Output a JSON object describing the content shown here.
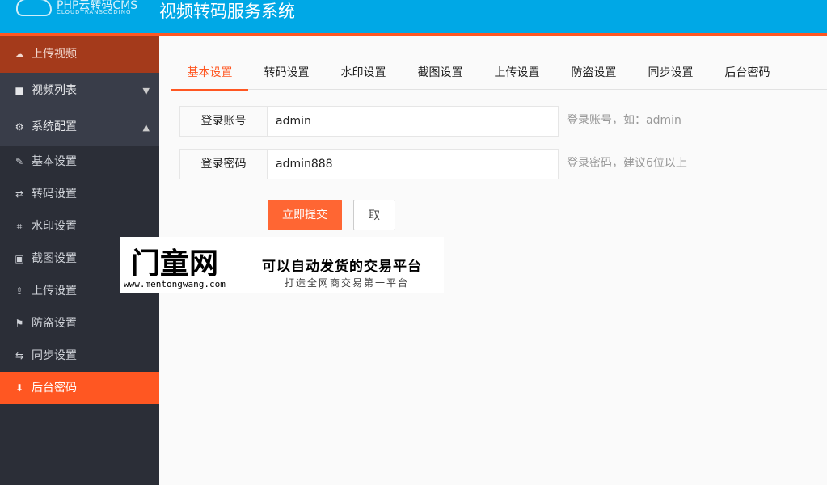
{
  "header": {
    "logo_name": "PHP云转码CMS",
    "logo_sub": "CLOUDTRANSCODING",
    "title": "视频转码服务系统"
  },
  "sidebar": {
    "upload": "上传视频",
    "video_list": "视频列表",
    "config": "系统配置",
    "items": [
      "基本设置",
      "转码设置",
      "水印设置",
      "截图设置",
      "上传设置",
      "防盗设置",
      "同步设置",
      "后台密码"
    ]
  },
  "tabs": [
    "基本设置",
    "转码设置",
    "水印设置",
    "截图设置",
    "上传设置",
    "防盗设置",
    "同步设置",
    "后台密码"
  ],
  "form": {
    "account_label": "登录账号",
    "account_value": "admin",
    "account_hint": "登录账号，如：admin",
    "password_label": "登录密码",
    "password_value": "admin888",
    "password_hint": "登录密码，建议6位以上",
    "submit": "立即提交",
    "cancel": "取"
  },
  "ad": {
    "brand": "门童网",
    "url": "www.mentongwang.com",
    "slogan": "可以自动发货的交易平台",
    "sub": "打造全网商交易第一平台"
  },
  "colors": {
    "accent": "#ff5722",
    "header": "#00a8e6"
  }
}
